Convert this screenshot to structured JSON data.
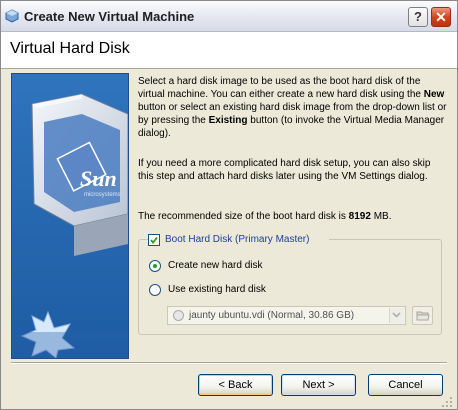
{
  "window": {
    "title": "Create New Virtual Machine",
    "help_label": "?",
    "close_label": "✕"
  },
  "header": {
    "title": "Virtual Hard Disk"
  },
  "description": {
    "para1_prefix": "Select a hard disk image to be used as the boot hard disk of the virtual machine. You can either create a new hard disk using the ",
    "new_word": "New",
    "para1_middle": " button or select an existing hard disk image from the drop-down list or by pressing the ",
    "existing_word": "Existing",
    "para1_suffix": " button (to invoke the Virtual Media Manager dialog).",
    "para2": "If you need a more complicated hard disk setup, you can also skip this step and attach hard disks later using the VM Settings dialog.",
    "para3_prefix": "The recommended size of the boot hard disk is ",
    "recommended_size": "8192",
    "para3_suffix": " MB."
  },
  "boot_disk": {
    "checkbox_label": "Boot Hard Disk (Primary Master)",
    "checked": true,
    "options": [
      {
        "label": "Create new hard disk",
        "selected": true
      },
      {
        "label": "Use existing hard disk",
        "selected": false
      }
    ],
    "existing_disk_value": "jaunty ubuntu.vdi (Normal, 30.86 GB)"
  },
  "buttons": {
    "back": "< Back",
    "next": "Next >",
    "cancel": "Cancel"
  },
  "side_image": {
    "brand_text": "Sun",
    "brand_subtext": "microsystems"
  },
  "colors": {
    "accent_blue": "#3a7fc4",
    "radio_green": "#21a121",
    "link_blue": "#1c3f9a"
  }
}
